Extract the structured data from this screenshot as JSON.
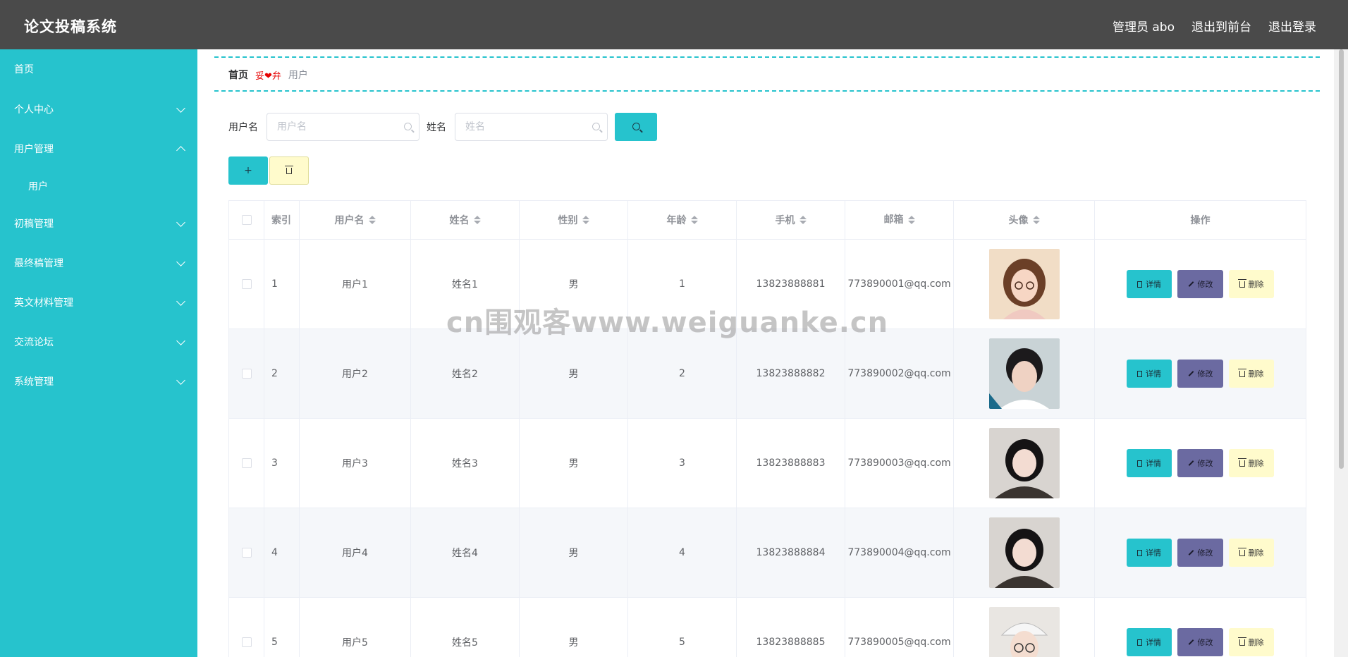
{
  "header": {
    "brand": "论文投稿系统",
    "admin_label": "管理员 abo",
    "to_frontend": "退出到前台",
    "logout": "退出登录"
  },
  "sidebar": {
    "items": [
      {
        "label": "首页",
        "expandable": false
      },
      {
        "label": "个人中心",
        "expandable": true,
        "expanded": false
      },
      {
        "label": "用户管理",
        "expandable": true,
        "expanded": true
      },
      {
        "label": "初稿管理",
        "expandable": true,
        "expanded": false
      },
      {
        "label": "最终稿管理",
        "expandable": true,
        "expanded": false
      },
      {
        "label": "英文材料管理",
        "expandable": true,
        "expanded": false
      },
      {
        "label": "交流论坛",
        "expandable": true,
        "expanded": false
      },
      {
        "label": "系统管理",
        "expandable": true,
        "expanded": false
      }
    ],
    "sub_items": [
      {
        "label": "用户",
        "parent": "用户管理"
      }
    ]
  },
  "breadcrumb": {
    "home": "首页",
    "separator": "妥❤弁",
    "current": "用户"
  },
  "search": {
    "username_label": "用户名",
    "username_placeholder": "用户名",
    "name_label": "姓名",
    "name_placeholder": "姓名"
  },
  "toolbar": {
    "add_label": "+"
  },
  "table": {
    "columns": [
      "索引",
      "用户名",
      "姓名",
      "性别",
      "年龄",
      "手机",
      "邮箱",
      "头像",
      "操作"
    ],
    "rows": [
      {
        "index": "1",
        "username": "用户1",
        "name": "姓名1",
        "gender": "男",
        "age": "1",
        "phone": "13823888881",
        "email": "773890001@qq.com"
      },
      {
        "index": "2",
        "username": "用户2",
        "name": "姓名2",
        "gender": "男",
        "age": "2",
        "phone": "13823888882",
        "email": "773890002@qq.com"
      },
      {
        "index": "3",
        "username": "用户3",
        "name": "姓名3",
        "gender": "男",
        "age": "3",
        "phone": "13823888883",
        "email": "773890003@qq.com"
      },
      {
        "index": "4",
        "username": "用户4",
        "name": "姓名4",
        "gender": "男",
        "age": "4",
        "phone": "13823888884",
        "email": "773890004@qq.com"
      },
      {
        "index": "5",
        "username": "用户5",
        "name": "姓名5",
        "gender": "男",
        "age": "5",
        "phone": "13823888885",
        "email": "773890005@qq.com"
      }
    ],
    "row_actions": {
      "detail": "详情",
      "edit": "修改",
      "delete": "删除"
    }
  },
  "watermark": "cn围观客www.weiguanke.cn",
  "colors": {
    "accent": "#26c3cd",
    "topbar": "#4a4a4a",
    "edit": "#6b6aa1",
    "delete": "#fffbcc"
  }
}
